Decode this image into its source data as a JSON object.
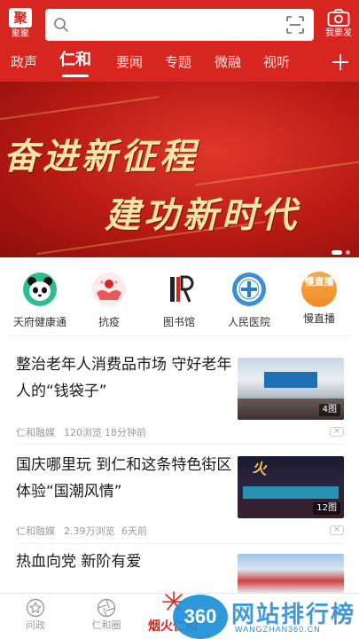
{
  "header": {
    "logo_label": "聚聚",
    "search_placeholder": "",
    "camera_label": "我要发"
  },
  "tabs": [
    {
      "label": "政声",
      "active": false
    },
    {
      "label": "仁和",
      "active": true
    },
    {
      "label": "要闻",
      "active": false
    },
    {
      "label": "专题",
      "active": false
    },
    {
      "label": "微融",
      "active": false
    },
    {
      "label": "视听",
      "active": false
    }
  ],
  "banner": {
    "line1": "奋进新征程",
    "line2": "建功新时代"
  },
  "shortcuts": [
    {
      "label": "天府健康通",
      "icon": "panda-health-icon"
    },
    {
      "label": "抗疫",
      "icon": "hands-care-icon"
    },
    {
      "label": "图书馆",
      "icon": "library-icon"
    },
    {
      "label": "人民医院",
      "icon": "hospital-emblem-icon"
    },
    {
      "label": "慢直播",
      "icon": "live-stream-icon"
    }
  ],
  "shortcut_extra": {
    "live_badge": "慢直播"
  },
  "articles": [
    {
      "title": "整治老年人消费品市场 守好老年人的“钱袋子”",
      "source": "仁和融媒",
      "views": "120浏览",
      "time": "18分钟前",
      "image_count": "4图"
    },
    {
      "title": "国庆哪里玩 到仁和这条特色街区体验“国潮风情”",
      "source": "仁和融媒",
      "views": "2.39万浏览",
      "time": "6天前",
      "image_count": "12图"
    },
    {
      "title": "热血向党 新阶有爱",
      "source": "",
      "views": "",
      "time": "",
      "image_count": ""
    }
  ],
  "bottom_nav": [
    {
      "label": "问政",
      "icon": "star-circle-icon"
    },
    {
      "label": "仁和圈",
      "icon": "aperture-icon"
    },
    {
      "label": "烟火仁和",
      "icon": "firework-icon"
    }
  ],
  "watermark": {
    "badge": "360",
    "text": "网站排行榜",
    "sub": "WANGZHAN360.CN"
  },
  "colors": {
    "brand_red": "#d7261f",
    "banner_gold": "#f6e6a6",
    "watermark_blue": "#2b8fd6"
  }
}
